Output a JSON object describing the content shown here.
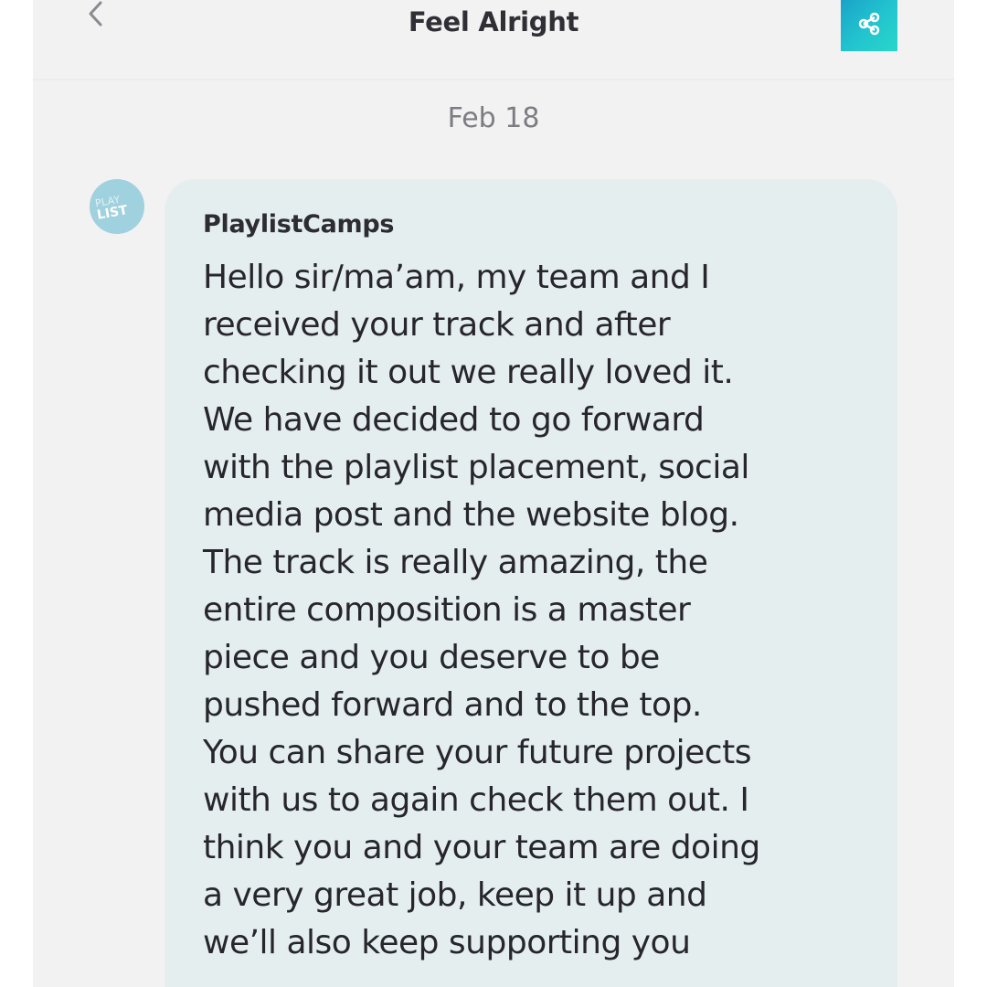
{
  "header": {
    "title": "Feel Alright",
    "back_icon": "chevron-left-icon",
    "share_icon": "share-icon",
    "share_gradient": [
      "#1aa3c8",
      "#28d7c8"
    ]
  },
  "thread": {
    "date_separator": "Feb 18",
    "messages": [
      {
        "sender": "PlaylistCamps",
        "avatar_text_top": "PLAY",
        "avatar_text_bottom": "LIST",
        "avatar_color": "#9fd1de",
        "bubble_color": "#e5eeef",
        "text": "Hello sir/ma’am, my team and I\nreceived your track and after\nchecking it out we really loved it.\nWe have decided to go forward\nwith the playlist placement, social\nmedia post and the website blog.\nThe track is really amazing, the\nentire composition is a master\npiece and you deserve to be\npushed forward and to the top.\nYou can share your future projects\nwith us to again check them out. I\nthink you and your team are doing\na very great job, keep it up and\nwe’ll also keep supporting you"
      }
    ]
  }
}
